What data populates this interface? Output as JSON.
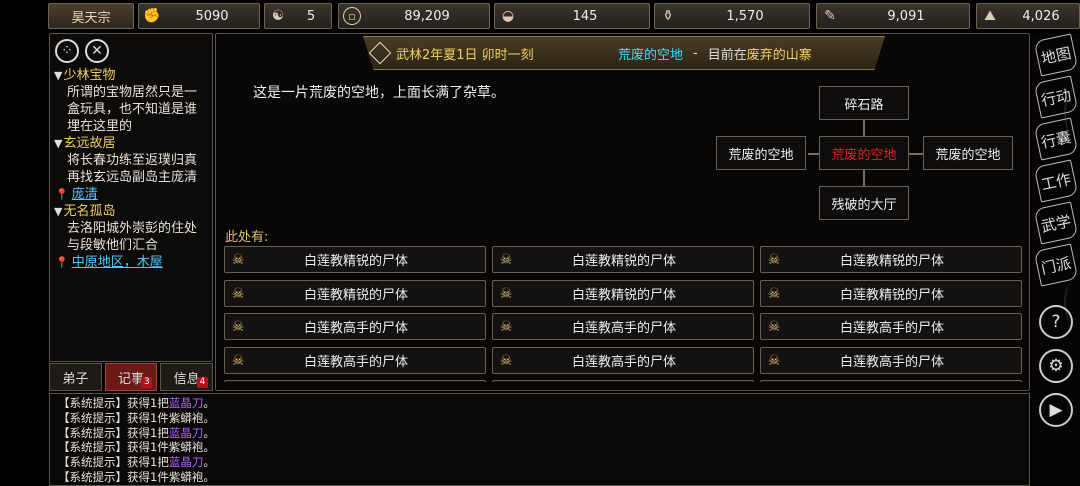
{
  "top_stats": [
    {
      "id": "sect",
      "value": "昊天宗",
      "icon": "banner"
    },
    {
      "id": "stat-1",
      "value": "5090",
      "icon": "fist-icon"
    },
    {
      "id": "stat-2",
      "value": "5",
      "icon": "yinyang-icon"
    },
    {
      "id": "coins",
      "value": "89,209",
      "icon": "coin-icon"
    },
    {
      "id": "food",
      "value": "145",
      "icon": "bowl-icon"
    },
    {
      "id": "stat-5",
      "value": "1,570",
      "icon": "gourd-icon"
    },
    {
      "id": "stat-6",
      "value": "9,091",
      "icon": "scroll-icon"
    },
    {
      "id": "stat-7",
      "value": "4,026",
      "icon": "ore-icon"
    }
  ],
  "quests": [
    {
      "title": "少林宝物",
      "desc": "所谓的宝物居然只是一盒玩具，也不知道是谁埋在这里的",
      "location": ""
    },
    {
      "title": "玄远故居",
      "desc": "将长春功练至返璞归真再找玄远岛副岛主庞清",
      "location": "庞清"
    },
    {
      "title": "无名孤岛",
      "desc": "去洛阳城外崇彭的住处与段敏他们汇合",
      "location": "中原地区，木屋"
    }
  ],
  "left_tabs": [
    {
      "label": "弟子",
      "badge": ""
    },
    {
      "label": "记事",
      "badge": "3"
    },
    {
      "label": "信息",
      "badge": "4"
    }
  ],
  "header": {
    "date": "武林2年夏1日 卯时一刻",
    "location": "荒废的空地",
    "separator": "-",
    "current_prefix": "目前在",
    "current_place": "废弃的山寨"
  },
  "scene_description": "这是一片荒废的空地，上面长满了杂草。",
  "minimap": {
    "north": "碎石路",
    "west": "荒废的空地",
    "center": "荒废的空地",
    "east": "荒废的空地",
    "south": "残破的大厅"
  },
  "here_label": "此处有:",
  "items": [
    "白莲教精锐的尸体",
    "白莲教精锐的尸体",
    "白莲教精锐的尸体",
    "白莲教精锐的尸体",
    "白莲教精锐的尸体",
    "白莲教精锐的尸体",
    "白莲教高手的尸体",
    "白莲教高手的尸体",
    "白莲教高手的尸体",
    "白莲教高手的尸体",
    "白莲教高手的尸体",
    "白莲教高手的尸体",
    "",
    "",
    ""
  ],
  "log": [
    {
      "prefix": "【系统提示】获得1把",
      "item": "蓝晶刀",
      "suffix": "。"
    },
    {
      "prefix": "【系统提示】获得1件紫蟒袍。",
      "item": "",
      "suffix": ""
    },
    {
      "prefix": "【系统提示】获得1把",
      "item": "蓝晶刀",
      "suffix": "。"
    },
    {
      "prefix": "【系统提示】获得1件紫蟒袍。",
      "item": "",
      "suffix": ""
    },
    {
      "prefix": "【系统提示】获得1把",
      "item": "蓝晶刀",
      "suffix": "。"
    },
    {
      "prefix": "【系统提示】获得1件紫蟒袍。",
      "item": "",
      "suffix": ""
    }
  ],
  "side_buttons": [
    "地图",
    "行动",
    "行囊",
    "工作",
    "武学",
    "门派"
  ],
  "side_icons": [
    "help-icon",
    "gear-icon",
    "play-icon"
  ],
  "side_icon_glyphs": [
    "?",
    "⚙",
    "▶"
  ]
}
